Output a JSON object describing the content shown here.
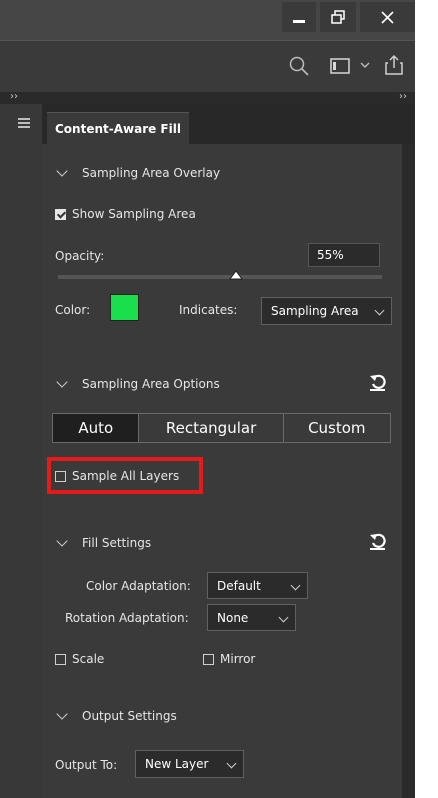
{
  "panel": {
    "tab_label": "Content-Aware Fill"
  },
  "strip": {
    "left_glyph": "››",
    "right_glyph": "››"
  },
  "overlay": {
    "title": "Sampling Area Overlay",
    "show_sampling_label": "Show Sampling Area",
    "show_sampling_checked": true,
    "opacity_label": "Opacity:",
    "opacity_value": "55%",
    "opacity_fraction": 0.55,
    "color_label": "Color:",
    "color_value": "#19e04a",
    "indicates_label": "Indicates:",
    "indicates_value": "Sampling Area"
  },
  "options": {
    "title": "Sampling Area Options",
    "segments": [
      "Auto",
      "Rectangular",
      "Custom"
    ],
    "selected": "Auto",
    "sample_all_label": "Sample All Layers",
    "sample_all_checked": false
  },
  "fill": {
    "title": "Fill Settings",
    "color_adaptation_label": "Color Adaptation:",
    "color_adaptation_value": "Default",
    "rotation_adaptation_label": "Rotation Adaptation:",
    "rotation_adaptation_value": "None",
    "scale_label": "Scale",
    "mirror_label": "Mirror"
  },
  "output": {
    "title": "Output Settings",
    "output_to_label": "Output To:",
    "output_to_value": "New Layer"
  },
  "colors": {
    "highlight": "#e51a1a",
    "swatch": "#19e04a"
  }
}
